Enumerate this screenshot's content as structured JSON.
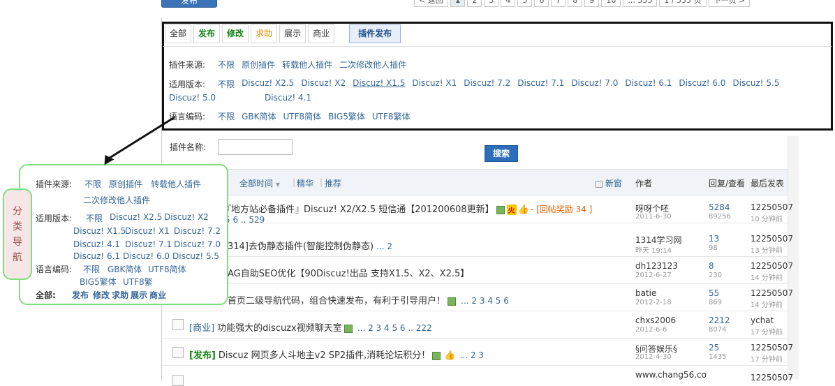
{
  "top": {
    "publish_label": "发布",
    "pager": [
      "< 返回",
      "1",
      "2",
      "3",
      "4",
      "5",
      "6",
      "7",
      "8",
      "9",
      "10",
      "... 555",
      "1 / 555 页",
      "下一页 >"
    ]
  },
  "tabs": [
    "全部",
    "发布",
    "修改",
    "求助",
    "展示",
    "商业",
    "插件发布"
  ],
  "filters": {
    "source": {
      "label": "插件来源:",
      "options": [
        "不限",
        "原创插件",
        "转载他人插件",
        "二次修改他人插件"
      ]
    },
    "version": {
      "label": "适用版本:",
      "options": [
        "不限",
        "Discuz! X2.5",
        "Discuz! X2",
        "Discuz! X1.5",
        "Discuz! X1",
        "Discuz! 7.2",
        "Discuz! 7.1",
        "Discuz! 7.0",
        "Discuz! 6.1",
        "Discuz! 6.0",
        "Discuz! 5.5",
        "Discuz! 5.0",
        "Discuz! 4.1"
      ]
    },
    "encoding": {
      "label": "语言编码:",
      "options": [
        "不限",
        "GBK简体",
        "UTF8简体",
        "BIG5繁体",
        "UTF8繁体"
      ]
    }
  },
  "search": {
    "label": "插件名称:",
    "button": "搜索",
    "placeholder": ""
  },
  "thead": {
    "time": "全部时间",
    "digest": "精华",
    "recommend": "推荐",
    "new_window": "新窗",
    "author": "作者",
    "replies": "回复/查看",
    "last_post": "最后发表"
  },
  "threads": [
    {
      "cat": "",
      "title": "『地方站必备插件』Discuz! X2/X2.5 短信通【201200608更新】",
      "pages": "5 6 .. 529",
      "hot": "火",
      "reward": "- [回帖奖励 34 ]",
      "author": "呀呀个呸",
      "date": "2011-6-30",
      "replies": "5284",
      "views": "89256",
      "last": "12250507",
      "last_time": "10 分钟前"
    },
    {
      "cat": "",
      "title": "314]去伪静态插件(智能控制伪静态)",
      "pages": "... 2",
      "author": "1314学习网",
      "date": "昨天 19:14",
      "replies": "13",
      "views": "98",
      "last": "12250507",
      "last_time": "13 分钟前"
    },
    {
      "cat": "",
      "title": "AG自助SEO优化【90Discuz!出品 支持X1.5、X2、X2.5】",
      "pages": "",
      "author": "dh123123",
      "date": "2012-6-27",
      "replies": "8",
      "views": "230",
      "last": "12250507",
      "last_time": "14 分钟前"
    },
    {
      "cat": "",
      "title": "首页二级导航代码，组合快速发布，有利于引导用户！",
      "pages": "... 2 3 4 5 6",
      "author": "batie",
      "date": "2012-2-18",
      "replies": "55",
      "views": "869",
      "last": "12250507",
      "last_time": "14 分钟前"
    },
    {
      "cat": "[商业]",
      "title": "功能强大的discuzx视频聊天室",
      "pages": "... 2 3 4 5 6 .. 222",
      "author": "chxs2006",
      "date": "2012-6-6",
      "replies": "2212",
      "views": "8074",
      "last": "ychat",
      "last_time": "17 分钟前"
    },
    {
      "cat": "[发布]",
      "title": "Discuz 网页多人斗地主v2 SP2插件,消耗论坛积分！",
      "pages": "... 2 3",
      "author": "§问答娱乐§",
      "date": "2012-4-30",
      "replies": "25",
      "views": "1435",
      "last": "12250507",
      "last_time": "17 分钟前"
    },
    {
      "cat": "",
      "title": "",
      "pages": "",
      "author": "www.chang56.co",
      "date": "",
      "replies": "",
      "views": "",
      "last": "12250507",
      "last_time": ""
    }
  ],
  "popup": {
    "source_label": "插件来源:",
    "source": [
      "不限",
      "原创插件",
      "转载他人插件",
      "二次修改他人插件"
    ],
    "version_label": "适用版本:",
    "version": [
      "不限",
      "Discuz! X2.5",
      "Discuz! X2",
      "Discuz! X1.5",
      "Discuz! X1",
      "Discuz! 7.2",
      "Discuz! 4.1",
      "Discuz! 7.1",
      "Discuz! 7.0",
      "Discuz! 6.1",
      "Discuz! 6.0",
      "Discuz! 5.5"
    ],
    "encoding_label": "语言编码:",
    "encoding": [
      "不限",
      "GBK简体",
      "UTF8简体",
      "BIG5繁体",
      "UTF8繁"
    ],
    "all_label": "全部:",
    "all": [
      "发布",
      "修改",
      "求助",
      "展示",
      "商业"
    ],
    "side_label": [
      "分",
      "类",
      "导",
      "航"
    ]
  },
  "colors": {
    "highlight_border": "#111111",
    "annotation_green": "#7fe07f",
    "link": "#336699",
    "button_blue": "#2e6dba"
  }
}
